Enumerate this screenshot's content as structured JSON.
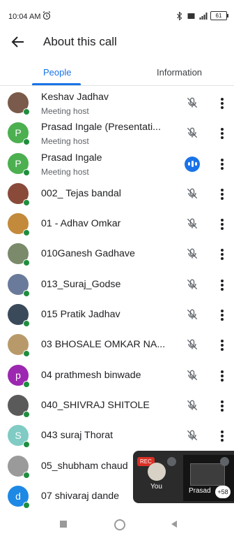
{
  "status_bar": {
    "time": "10:04 AM",
    "battery": "61"
  },
  "header": {
    "title": "About this call"
  },
  "tabs": [
    {
      "label": "People"
    },
    {
      "label": "Information"
    }
  ],
  "participants": [
    {
      "name": "Keshav Jadhav",
      "role": "Meeting host",
      "avatar": "photo",
      "color": "#7a5a4a",
      "mic": "muted"
    },
    {
      "name": "Prasad Ingale (Presentati...",
      "role": "Meeting host",
      "avatar": "P",
      "color": "#4caf50",
      "mic": "muted"
    },
    {
      "name": "Prasad Ingale",
      "role": "Meeting host",
      "avatar": "P",
      "color": "#4caf50",
      "mic": "speaking"
    },
    {
      "name": "002_ Tejas bandal",
      "role": "",
      "avatar": "photo",
      "color": "#8a4a3a",
      "mic": "muted"
    },
    {
      "name": "01 - Adhav Omkar",
      "role": "",
      "avatar": "photo",
      "color": "#c28a3a",
      "mic": "muted"
    },
    {
      "name": "010Ganesh Gadhave",
      "role": "",
      "avatar": "photo",
      "color": "#7a8a6a",
      "mic": "muted"
    },
    {
      "name": "013_Suraj_Godse",
      "role": "",
      "avatar": "photo",
      "color": "#6a7a9a",
      "mic": "muted"
    },
    {
      "name": "015 Pratik Jadhav",
      "role": "",
      "avatar": "photo",
      "color": "#3a4a5a",
      "mic": "muted"
    },
    {
      "name": "03 BHOSALE OMKAR NA...",
      "role": "",
      "avatar": "photo",
      "color": "#b89a6a",
      "mic": "muted"
    },
    {
      "name": "04 prathmesh binwade",
      "role": "",
      "avatar": "p",
      "color": "#9c27b0",
      "mic": "muted"
    },
    {
      "name": "040_SHIVRAJ SHITOLE",
      "role": "",
      "avatar": "photo",
      "color": "#5a5a5a",
      "mic": "muted"
    },
    {
      "name": "043 suraj Thorat",
      "role": "",
      "avatar": "S",
      "color": "#80cbc4",
      "mic": "muted"
    },
    {
      "name": "05_shubham chaud",
      "role": "",
      "avatar": "photo",
      "color": "#9a9a9a",
      "mic": "none"
    },
    {
      "name": "07 shivaraj dande",
      "role": "",
      "avatar": "d",
      "color": "#1e88e5",
      "mic": "none"
    }
  ],
  "pip": {
    "rec_label": "REC",
    "self_label": "You",
    "presenter_label": "Prasad",
    "overflow_count": "+58"
  }
}
